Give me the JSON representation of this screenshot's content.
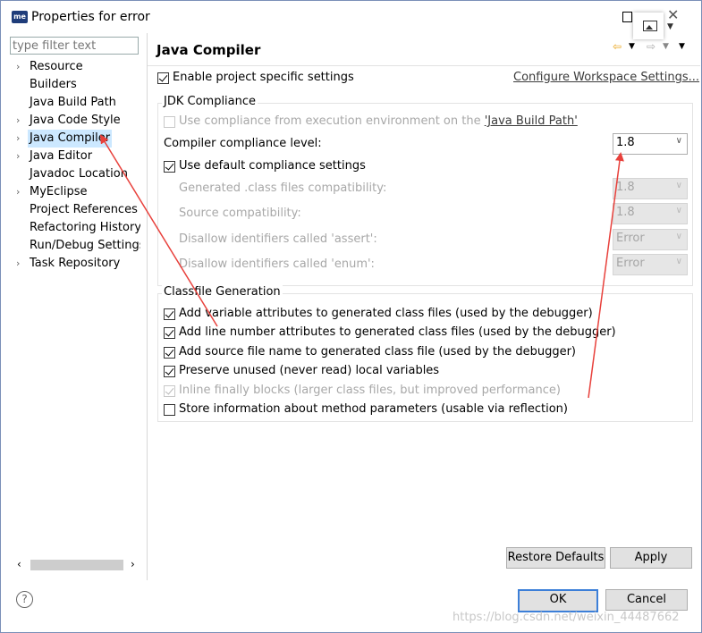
{
  "window": {
    "title": "Properties for error",
    "app_badge": "me"
  },
  "filter": {
    "placeholder": "type filter text"
  },
  "tree": [
    {
      "label": "Resource",
      "expandable": true,
      "selected": false
    },
    {
      "label": "Builders",
      "expandable": false,
      "selected": false
    },
    {
      "label": "Java Build Path",
      "expandable": false,
      "selected": false
    },
    {
      "label": "Java Code Style",
      "expandable": true,
      "selected": false
    },
    {
      "label": "Java Compiler",
      "expandable": true,
      "selected": true
    },
    {
      "label": "Java Editor",
      "expandable": true,
      "selected": false
    },
    {
      "label": "Javadoc Location",
      "expandable": false,
      "selected": false
    },
    {
      "label": "MyEclipse",
      "expandable": true,
      "selected": false
    },
    {
      "label": "Project References",
      "expandable": false,
      "selected": false
    },
    {
      "label": "Refactoring History",
      "expandable": false,
      "selected": false
    },
    {
      "label": "Run/Debug Settings",
      "expandable": false,
      "selected": false
    },
    {
      "label": "Task Repository",
      "expandable": true,
      "selected": false
    }
  ],
  "page": {
    "title": "Java Compiler",
    "enable_specific": "Enable project specific settings",
    "configure_link": "Configure Workspace Settings..."
  },
  "jdk": {
    "group_title": "JDK Compliance",
    "use_env_prefix": "Use compliance from execution environment on the ",
    "use_env_link": "'Java Build Path'",
    "compliance_label": "Compiler compliance level:",
    "compliance_value": "1.8",
    "use_default": "Use default compliance settings",
    "generated_label": "Generated .class files compatibility:",
    "generated_value": "1.8",
    "source_label": "Source compatibility:",
    "source_value": "1.8",
    "assert_label": "Disallow identifiers called 'assert':",
    "assert_value": "Error",
    "enum_label": "Disallow identifiers called 'enum':",
    "enum_value": "Error"
  },
  "classfile": {
    "group_title": "Classfile Generation",
    "items": [
      {
        "label": "Add variable attributes to generated class files (used by the debugger)",
        "checked": true,
        "enabled": true
      },
      {
        "label": "Add line number attributes to generated class files (used by the debugger)",
        "checked": true,
        "enabled": true
      },
      {
        "label": "Add source file name to generated class file (used by the debugger)",
        "checked": true,
        "enabled": true
      },
      {
        "label": "Preserve unused (never read) local variables",
        "checked": true,
        "enabled": true
      },
      {
        "label": "Inline finally blocks (larger class files, but improved performance)",
        "checked": true,
        "enabled": false
      },
      {
        "label": "Store information about method parameters (usable via reflection)",
        "checked": false,
        "enabled": true
      }
    ]
  },
  "buttons": {
    "restore": "Restore Defaults",
    "apply": "Apply",
    "ok": "OK",
    "cancel": "Cancel",
    "help": "?"
  },
  "watermark": "https://blog.csdn.net/weixin_44487662",
  "colors": {
    "selection": "#cce8ff",
    "default_button_border": "#3c7fd8",
    "annotation_arrow": "#e8413c"
  }
}
